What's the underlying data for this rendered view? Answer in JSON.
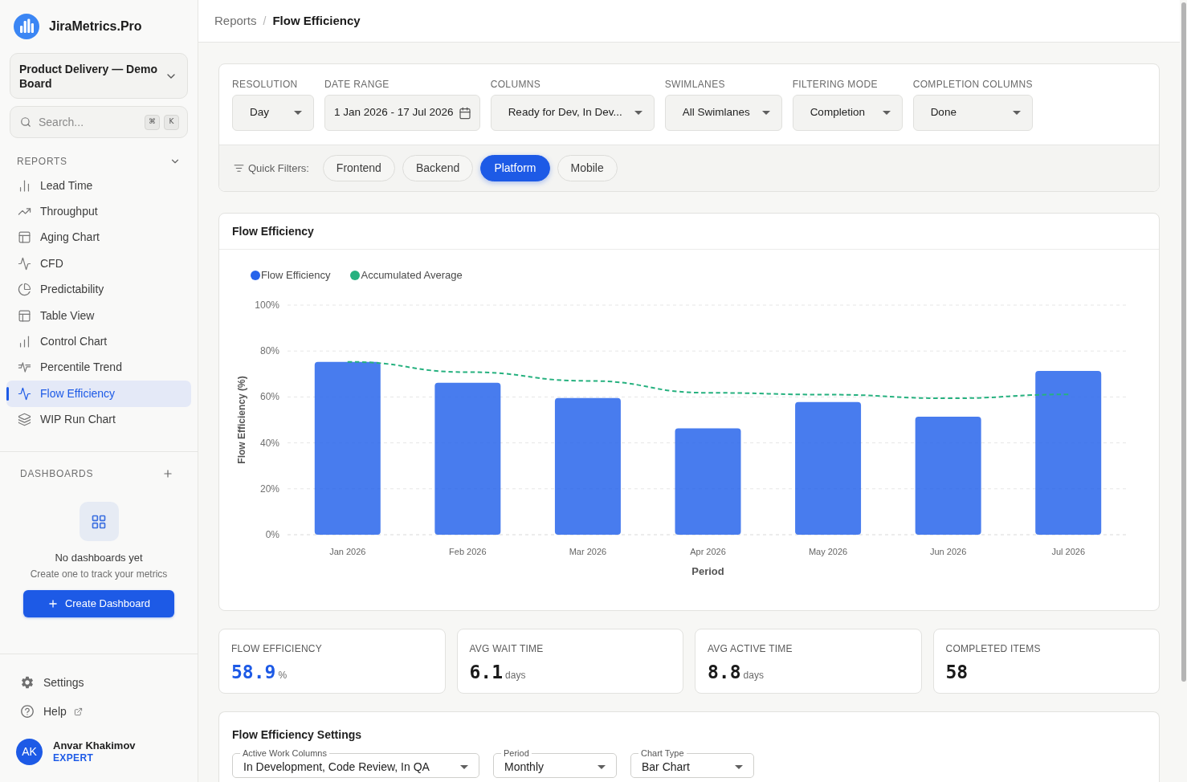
{
  "sidebar": {
    "brand": "JiraMetrics.Pro",
    "board_selector": {
      "value": "Product Delivery — Demo Board"
    },
    "search": {
      "placeholder": "Search...",
      "shortcut": [
        "⌘",
        "K"
      ]
    },
    "reports": {
      "heading": "REPORTS",
      "expanded": true,
      "items": [
        {
          "label": "Lead Time",
          "selected": false
        },
        {
          "label": "Throughput",
          "selected": false
        },
        {
          "label": "Aging Chart",
          "selected": false
        },
        {
          "label": "CFD",
          "selected": false
        },
        {
          "label": "Predictability",
          "selected": false
        },
        {
          "label": "Table View",
          "selected": false
        },
        {
          "label": "Control Chart",
          "selected": false
        },
        {
          "label": "Percentile Trend",
          "selected": false
        },
        {
          "label": "Flow Efficiency",
          "selected": true
        },
        {
          "label": "WIP Run Chart",
          "selected": false
        }
      ]
    },
    "dashboards": {
      "heading": "DASHBOARDS",
      "empty_title": "No dashboards yet",
      "empty_text": "Create one to track your metrics",
      "create_button": "Create Dashboard"
    },
    "footer_links": [
      {
        "label": "Settings",
        "external": false
      },
      {
        "label": "Help",
        "external": true
      }
    ],
    "user": {
      "initials": "AK",
      "name": "Anvar Khakimov",
      "role": "EXPERT"
    }
  },
  "breadcrumb": {
    "separator": "/",
    "items": [
      {
        "label": "Reports",
        "current": false
      },
      {
        "label": "Flow Efficiency",
        "current": true
      }
    ]
  },
  "filters": [
    {
      "kind": "select",
      "label": "RESOLUTION",
      "value": "Day"
    },
    {
      "kind": "date",
      "label": "DATE RANGE",
      "value": "1 Jan 2026 - 17 Jul 2026"
    },
    {
      "kind": "select",
      "label": "COLUMNS",
      "value": "Ready for Dev, In Dev..."
    },
    {
      "kind": "select",
      "label": "SWIMLANES",
      "value": "All Swimlanes"
    },
    {
      "kind": "select",
      "label": "FILTERING MODE",
      "value": "Completion"
    },
    {
      "kind": "select",
      "label": "COMPLETION COLUMNS",
      "value": "Done"
    }
  ],
  "quick_filters": {
    "label": "Quick Filters:",
    "chips": [
      {
        "label": "Frontend",
        "selected": false
      },
      {
        "label": "Backend",
        "selected": false
      },
      {
        "label": "Platform",
        "selected": true
      },
      {
        "label": "Mobile",
        "selected": false
      }
    ]
  },
  "chart_panel": {
    "title": "Flow Efficiency",
    "chart_data": {
      "type": "bar",
      "xlabel": "Period",
      "ylabel": "Flow Efficiency (%)",
      "categories": [
        "Jan 2026",
        "Feb 2026",
        "Mar 2026",
        "Apr 2026",
        "May 2026",
        "Jun 2026",
        "Jul 2026"
      ],
      "series": [
        {
          "name": "Flow Efficiency",
          "color": "#2563eb",
          "values": [
            75.3,
            66.2,
            59.5,
            46.3,
            57.8,
            51.4,
            71.3
          ]
        },
        {
          "name": "Accumulated Average",
          "type": "line",
          "line_style": "dashed",
          "color": "#26b17f",
          "values": [
            75.3,
            70.8,
            67.0,
            61.8,
            61.0,
            59.4,
            61.1
          ]
        }
      ],
      "ylim": [
        0,
        100
      ],
      "yticks": [
        {
          "value": 0,
          "label": "0%"
        },
        {
          "value": 20,
          "label": "20%"
        },
        {
          "value": 40,
          "label": "40%"
        },
        {
          "value": 60,
          "label": "60%"
        },
        {
          "value": 80,
          "label": "80%"
        },
        {
          "value": 100,
          "label": "100%"
        }
      ],
      "grid": true,
      "legend": "top-left"
    }
  },
  "stats": [
    {
      "label": "FLOW EFFICIENCY",
      "value": "58.9",
      "unit": "%",
      "accent": true
    },
    {
      "label": "AVG WAIT TIME",
      "value": "6.1",
      "unit": "days",
      "accent": false
    },
    {
      "label": "AVG ACTIVE TIME",
      "value": "8.8",
      "unit": "days",
      "accent": false
    },
    {
      "label": "COMPLETED ITEMS",
      "value": "58",
      "accent": false
    }
  ],
  "settings_panel": {
    "title": "Flow Efficiency Settings",
    "fields": [
      {
        "label": "Active Work Columns",
        "value": "In Development, Code Review, In QA"
      },
      {
        "label": "Period",
        "value": "Monthly"
      },
      {
        "label": "Chart Type",
        "value": "Bar Chart"
      }
    ]
  }
}
